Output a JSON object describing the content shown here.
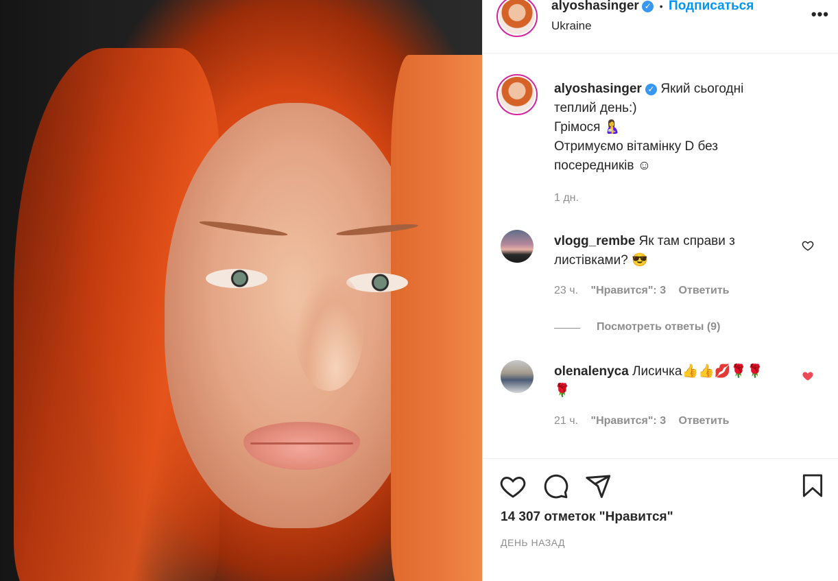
{
  "post": {
    "username": "alyoshasinger",
    "follow_label": "Подписаться",
    "dot": "•",
    "location": "Ukraine",
    "more_label": "•••",
    "caption_line1": "Який сьогодні",
    "caption_line2": "теплий день:)",
    "caption_line3": "Грімося 🤱",
    "caption_line4": "Отримуємо вітамінку D без",
    "caption_line5": "посередників ☺",
    "caption_time": "1 дн."
  },
  "comments": [
    {
      "username": "vlogg_rembe",
      "text_line1": "Як там справи з",
      "text_line2": "листівками? 😎",
      "time": "23 ч.",
      "likes_label": "\"Нравится\": 3",
      "reply_label": "Ответить",
      "view_replies": "Посмотреть ответы (9)",
      "liked": false
    },
    {
      "username": "olenalenyca",
      "text_line1": "Лисичка👍👍💋🌹🌹",
      "text_line2": "🌹",
      "time": "21 ч.",
      "likes_label": "\"Нравится\": 3",
      "reply_label": "Ответить",
      "liked": true
    }
  ],
  "footer": {
    "likes_text": "14 307 отметок \"Нравится\"",
    "time_text": "ДЕНЬ НАЗАД"
  },
  "colors": {
    "link": "#0095f6",
    "verified": "#3897f0",
    "liked_heart": "#ed4956",
    "muted": "#8e8e8e"
  }
}
